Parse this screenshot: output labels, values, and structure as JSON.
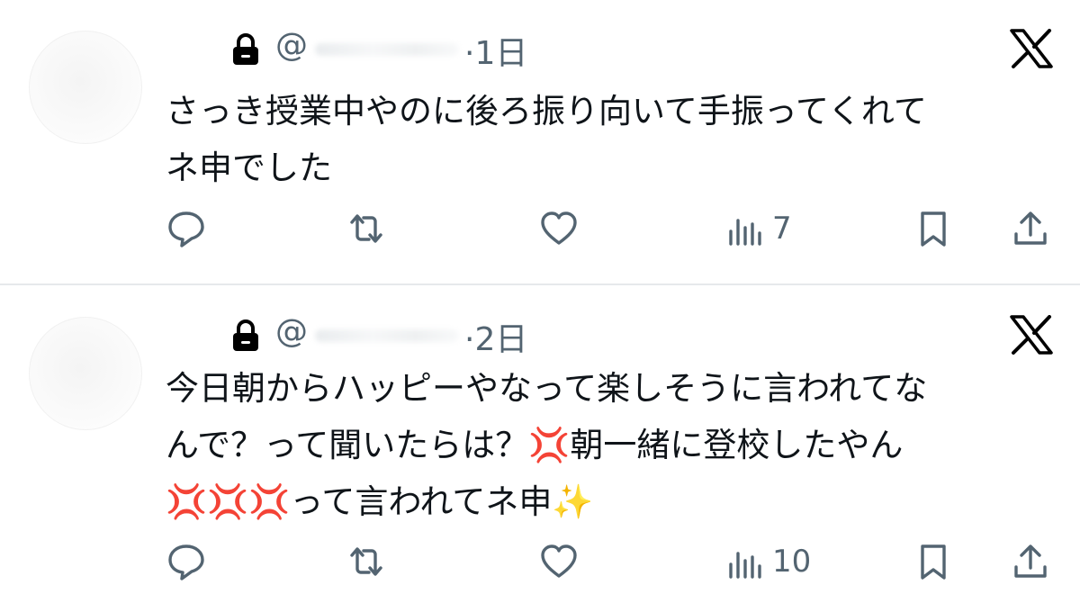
{
  "tweets": [
    {
      "handle_prefix": "@",
      "time": "·1日",
      "text": "さっき授業中やのに後ろ振り向いて手振ってくれて\nネ申でした",
      "views": "7"
    },
    {
      "handle_prefix": "@",
      "time": "·2日",
      "text": "今日朝からハッピーやなって楽しそうに言われてな\nんで？って聞いたらは？💢朝一緒に登校したやん\n💢💢💢って言われてネ申✨",
      "views": "10"
    }
  ],
  "colors": {
    "text": "#0f1419",
    "secondary": "#536471",
    "divider": "#e6e9eb"
  },
  "icons": [
    "lock-icon",
    "x-logo-icon",
    "reply-icon",
    "retweet-icon",
    "like-icon",
    "views-icon",
    "bookmark-icon",
    "share-icon"
  ]
}
